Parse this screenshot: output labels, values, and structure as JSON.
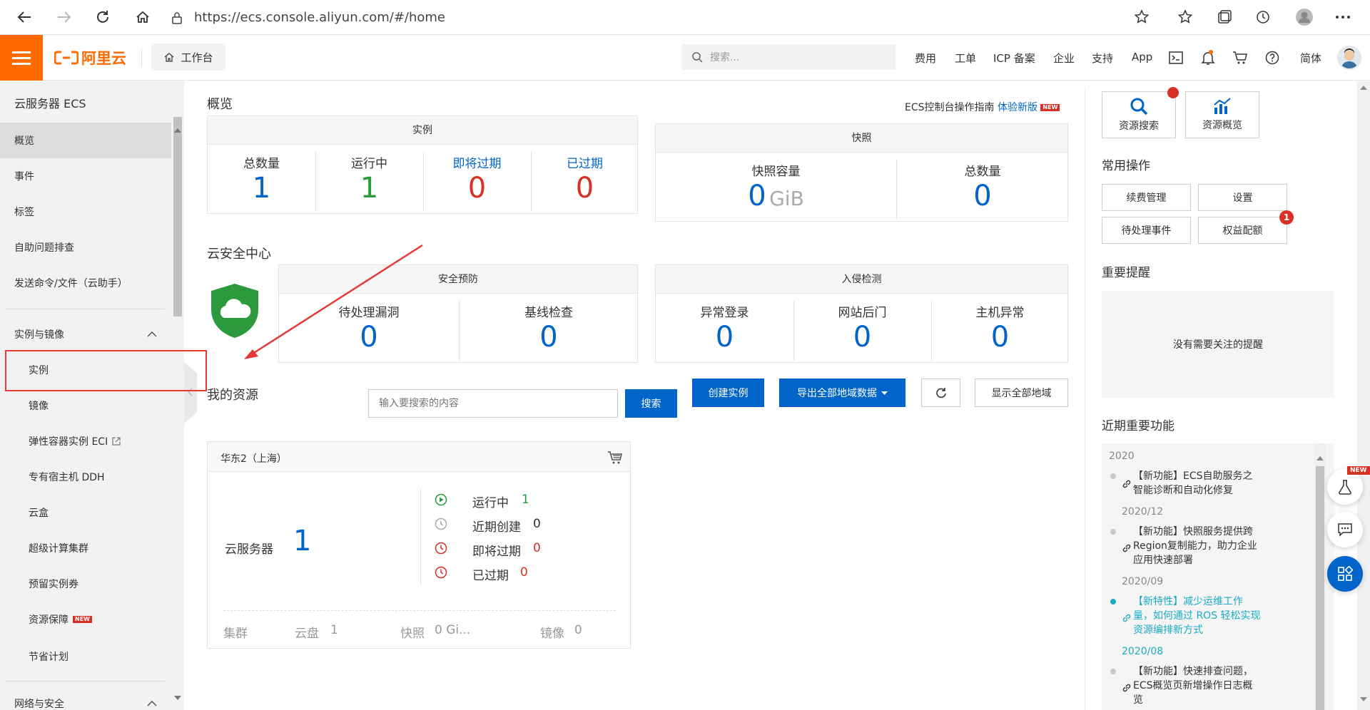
{
  "browser": {
    "url": "https://ecs.console.aliyun.com/#/home"
  },
  "header": {
    "logo_text": "阿里云",
    "workbench": "工作台",
    "search_placeholder": "搜索...",
    "nav": [
      "费用",
      "工单",
      "ICP 备案",
      "企业",
      "支持",
      "App"
    ],
    "lang": "简体",
    "notification_color": "#ff6a00"
  },
  "sidebar": {
    "title": "云服务器 ECS",
    "items": [
      "概览",
      "事件",
      "标签",
      "自助问题排查",
      "发送命令/文件（云助手）"
    ],
    "group1": "实例与镜像",
    "sub": [
      "实例",
      "镜像",
      "弹性容器实例 ECI",
      "专有宿主机 DDH",
      "云盒",
      "超级计算集群",
      "预留实例券",
      "资源保障",
      "节省计划"
    ],
    "group2": "网络与安全",
    "new_badge": "NEW"
  },
  "main": {
    "overview_title": "概览",
    "guide_text": "ECS控制台操作指南",
    "guide_link": "体验新版",
    "instances": {
      "title": "实例",
      "cols": [
        {
          "label": "总数量",
          "value": "1"
        },
        {
          "label": "运行中",
          "value": "1"
        },
        {
          "label": "即将过期",
          "value": "0"
        },
        {
          "label": "已过期",
          "value": "0"
        }
      ]
    },
    "snapshots": {
      "title": "快照",
      "capacity_label": "快照容量",
      "capacity_value": "0",
      "capacity_unit": "GiB",
      "total_label": "总数量",
      "total_value": "0"
    },
    "security_title": "云安全中心",
    "prevention": {
      "title": "安全预防",
      "cols": [
        {
          "label": "待处理漏洞",
          "value": "0"
        },
        {
          "label": "基线检查",
          "value": "0"
        }
      ]
    },
    "intrusion": {
      "title": "入侵检测",
      "cols": [
        {
          "label": "异常登录",
          "value": "0"
        },
        {
          "label": "网站后门",
          "value": "0"
        },
        {
          "label": "主机异常",
          "value": "0"
        }
      ]
    },
    "resources_title": "我的资源",
    "resource_search_placeholder": "输入要搜索的内容",
    "search_btn": "搜索",
    "create_btn": "创建实例",
    "export_btn": "导出全部地域数据",
    "show_all_btn": "显示全部地域",
    "region": {
      "name": "华东2（上海）",
      "server_label": "云服务器",
      "server_count": "1",
      "statuses": [
        {
          "label": "运行中",
          "value": "1"
        },
        {
          "label": "近期创建",
          "value": "0"
        },
        {
          "label": "即将过期",
          "value": "0"
        },
        {
          "label": "已过期",
          "value": "0"
        }
      ],
      "footer": [
        {
          "label": "集群",
          "value": ""
        },
        {
          "label": "云盘",
          "value": "1"
        },
        {
          "label": "快照",
          "value": "0 Gi..."
        },
        {
          "label": "镜像",
          "value": "0"
        }
      ]
    }
  },
  "right": {
    "quick": [
      "资源搜索",
      "资源概览"
    ],
    "ops_title": "常用操作",
    "ops": [
      "续费管理",
      "设置",
      "待处理事件",
      "权益配额"
    ],
    "ops_badge": "1",
    "alert_title": "重要提醒",
    "alert_empty": "没有需要关注的提醒",
    "recent_title": "近期重要功能",
    "timeline": [
      {
        "year": "2020",
        "text": [
          "【新功能】ECS自助服务之",
          "智能诊断和自动化修复"
        ]
      },
      {
        "year": "2020/12",
        "text": [
          "【新功能】快照服务提供跨",
          "Region复制能力，助力企业",
          "应用快速部署"
        ]
      },
      {
        "year": "2020/09",
        "text": [
          "【新特性】减少运维工作",
          "量，如何通过 ROS 轻松实现",
          "资源编排新方式"
        ]
      },
      {
        "year": "2020/08",
        "text": [
          "【新功能】快速排查问题，",
          "ECS概览页新增操作日志概",
          "览"
        ]
      }
    ],
    "float_new": "NEW"
  }
}
